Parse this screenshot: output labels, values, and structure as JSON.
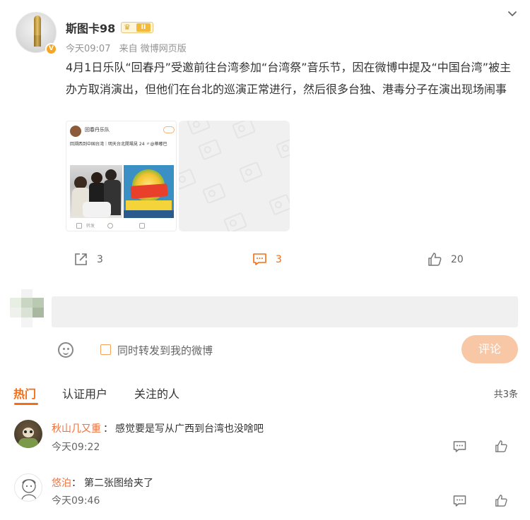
{
  "post": {
    "username": "斯图卡98",
    "level_label": "II",
    "time": "今天09:07",
    "source": "来自 微博网页版",
    "text": "4月1日乐队“回春丹”受邀前往台湾参加“台湾祭”音乐节，因在微博中提及“中国台湾”被主办方取消演出，但他们在台北的巡演正常进行，然后很多台独、港毒分子在演出现场闹事",
    "image1": {
      "account": "回春丹乐队",
      "line": "回溯西到中国台湾｜明天台北開場見 24 〃@蒂嘟巴",
      "footer_label": "转发"
    },
    "actions": {
      "repost_count": "3",
      "comment_count": "3",
      "like_count": "20"
    }
  },
  "composer": {
    "placeholder": "",
    "forward_label": "同时转发到我的微博",
    "submit_label": "评论"
  },
  "tabs": [
    "热门",
    "认证用户",
    "关注的人"
  ],
  "total_label": "共3条",
  "comments": [
    {
      "name": "秋山几又重",
      "text": "感觉要是写从广西到台湾也没啥吧",
      "time": "今天09:22"
    },
    {
      "name": "悠泊",
      "text": "第二张图给夹了",
      "time": "今天09:46"
    }
  ],
  "colors": {
    "accent": "#f46d14",
    "username_link": "#eb7340",
    "submit_disabled": "#f8c7a6",
    "input_bg": "#f0f0f0"
  }
}
